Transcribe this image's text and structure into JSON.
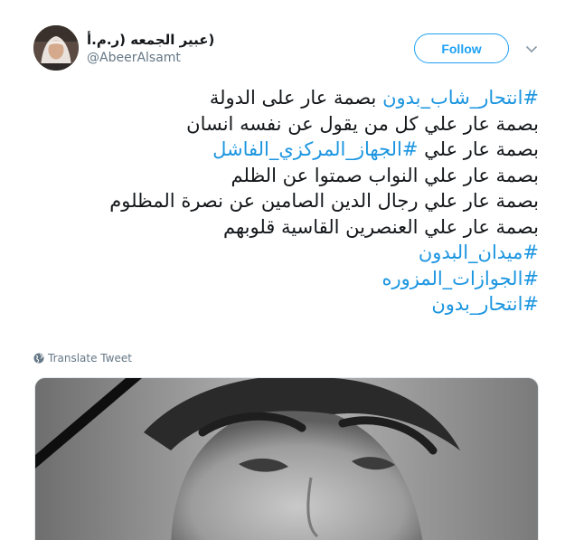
{
  "author": {
    "display_name": "(عبير الجمعه (ر.م.أ",
    "handle": "@AbeerAlsamt"
  },
  "actions": {
    "follow_label": "Follow"
  },
  "tweet": {
    "lines": [
      [
        {
          "text": "#انتحار_شاب_بدون",
          "hashtag": true
        },
        {
          "text": " بصمة عار على الدولة",
          "hashtag": false
        }
      ],
      [
        {
          "text": "بصمة عار علي كل من يقول عن نفسه انسان",
          "hashtag": false
        }
      ],
      [
        {
          "text": "بصمة عار علي ",
          "hashtag": false
        },
        {
          "text": "#الجهاز_المركزي_الفاشل",
          "hashtag": true
        }
      ],
      [
        {
          "text": "بصمة عار علي النواب صمتوا عن الظلم",
          "hashtag": false
        }
      ],
      [
        {
          "text": "بصمة عار علي رجال الدين الصامين عن نصرة المظلوم",
          "hashtag": false
        }
      ],
      [
        {
          "text": "بصمة عار علي العنصرين القاسية قلوبهم",
          "hashtag": false
        }
      ],
      [
        {
          "text": "#ميدان_البدون",
          "hashtag": true
        }
      ],
      [
        {
          "text": "#الجوازات_المزوره",
          "hashtag": true
        }
      ],
      [
        {
          "text": "#انتحار_بدون",
          "hashtag": true
        }
      ]
    ]
  },
  "translate": {
    "label": "Translate Tweet",
    "icon": "globe-icon"
  },
  "media": {
    "description": "",
    "icons": [
      "mourning-ribbon-icon"
    ]
  },
  "colors": {
    "accent": "#1da1f2",
    "hashtag": "#1b95e0",
    "text": "#14171a",
    "muted": "#657786"
  }
}
